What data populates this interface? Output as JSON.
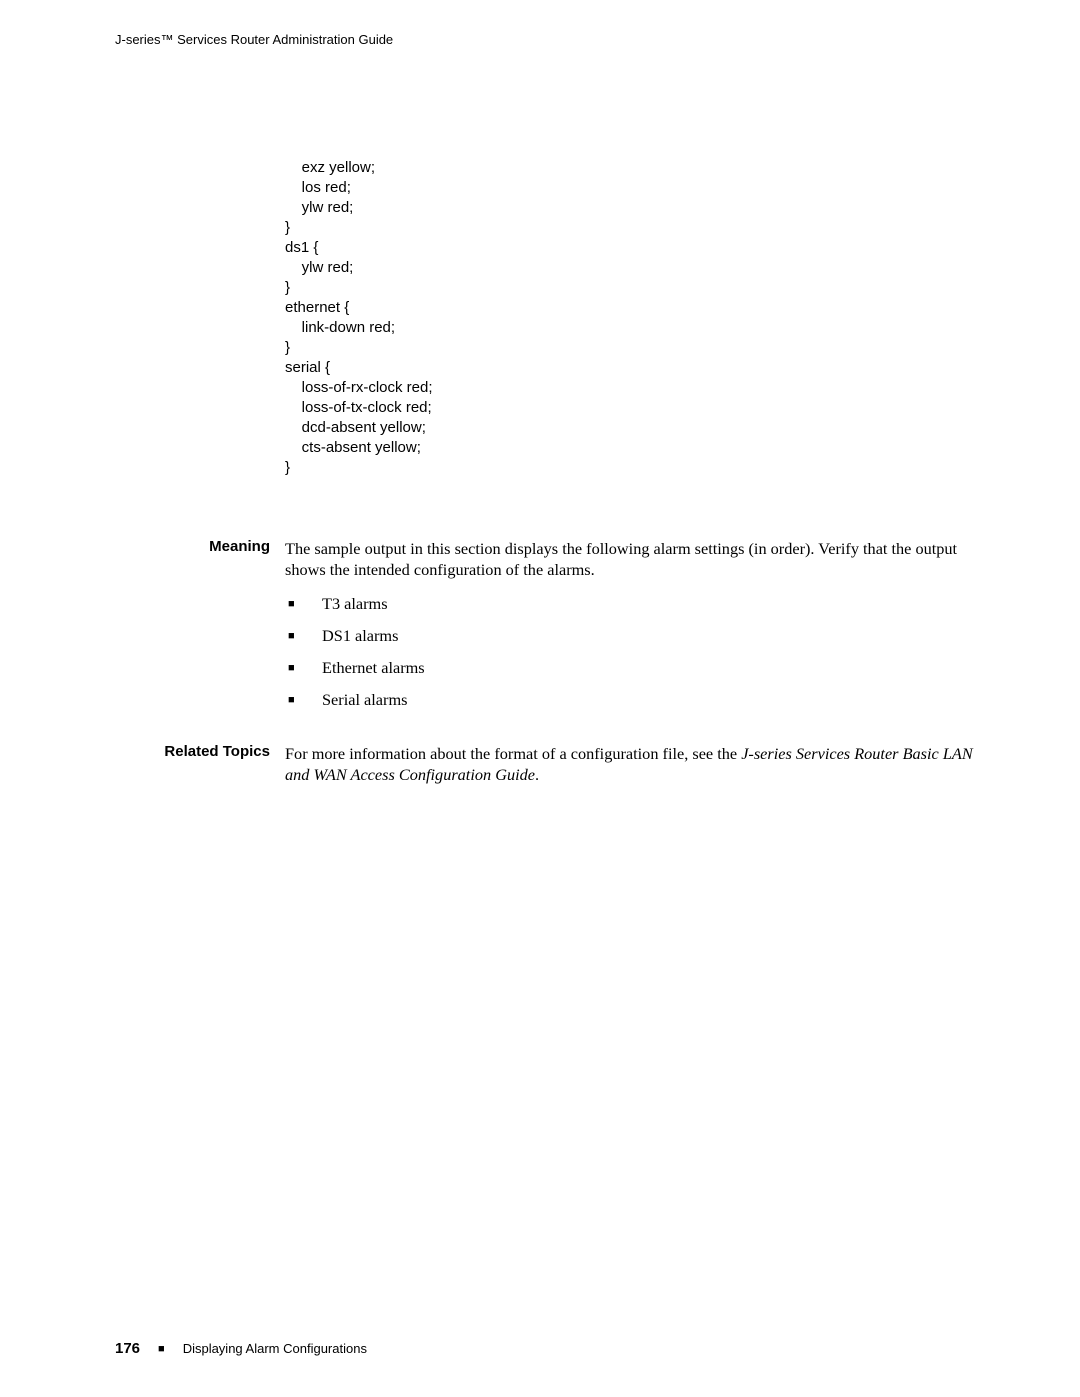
{
  "header": {
    "running_title": "J-series™ Services Router Administration Guide"
  },
  "code": {
    "text": "    exz yellow;\n    los red;\n    ylw red;\n}\nds1 {\n    ylw red;\n}\nethernet {\n    link-down red;\n}\nserial {\n    loss-of-rx-clock red;\n    loss-of-tx-clock red;\n    dcd-absent yellow;\n    cts-absent yellow;\n}"
  },
  "sections": {
    "meaning": {
      "label": "Meaning",
      "body": "The sample output in this section displays the following alarm settings (in order). Verify that the output shows the intended configuration of the alarms."
    },
    "list": [
      "T3 alarms",
      "DS1 alarms",
      "Ethernet alarms",
      "Serial alarms"
    ],
    "related": {
      "label": "Related Topics",
      "body_prefix": "For more information about the format of a configuration file, see the ",
      "body_italic": "J-series Services Router Basic LAN and WAN Access Configuration Guide",
      "body_suffix": "."
    }
  },
  "footer": {
    "page_number": "176",
    "section_title": "Displaying Alarm Configurations"
  }
}
